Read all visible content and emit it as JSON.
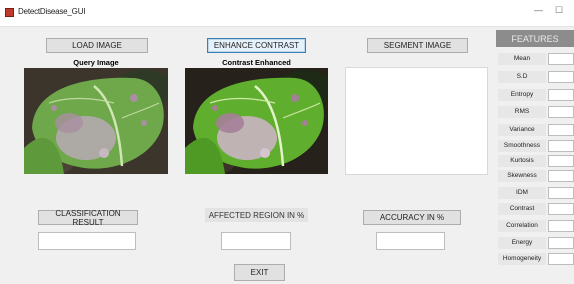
{
  "window": {
    "title": "DetectDisease_GUI",
    "minimize_glyph": "—",
    "maximize_glyph": "☐"
  },
  "buttons": {
    "load_image": "LOAD IMAGE",
    "enhance_contrast": "ENHANCE CONTRAST",
    "segment_image": "SEGMENT IMAGE",
    "classification_result": "CLASSIFICATION RESULT",
    "accuracy": "ACCURACY in %",
    "exit": "EXIT"
  },
  "labels": {
    "query_image": "Query Image",
    "contrast_enhanced": "Contrast Enhanced",
    "affected_region": "AFFECTED REGION in %"
  },
  "features": {
    "header": "FEATURES",
    "items": [
      "Mean",
      "S.D",
      "Entropy",
      "RMS",
      "Variance",
      "Smoothness",
      "Kurtosis",
      "Skewness",
      "IDM",
      "Contrast",
      "Correlation",
      "Energy",
      "Homogeneity"
    ]
  },
  "colors": {
    "leaf_green": "#6fa84a",
    "leaf_light": "#9cc86e",
    "soil": "#3a3328",
    "lesion": "#b9a9b4"
  }
}
